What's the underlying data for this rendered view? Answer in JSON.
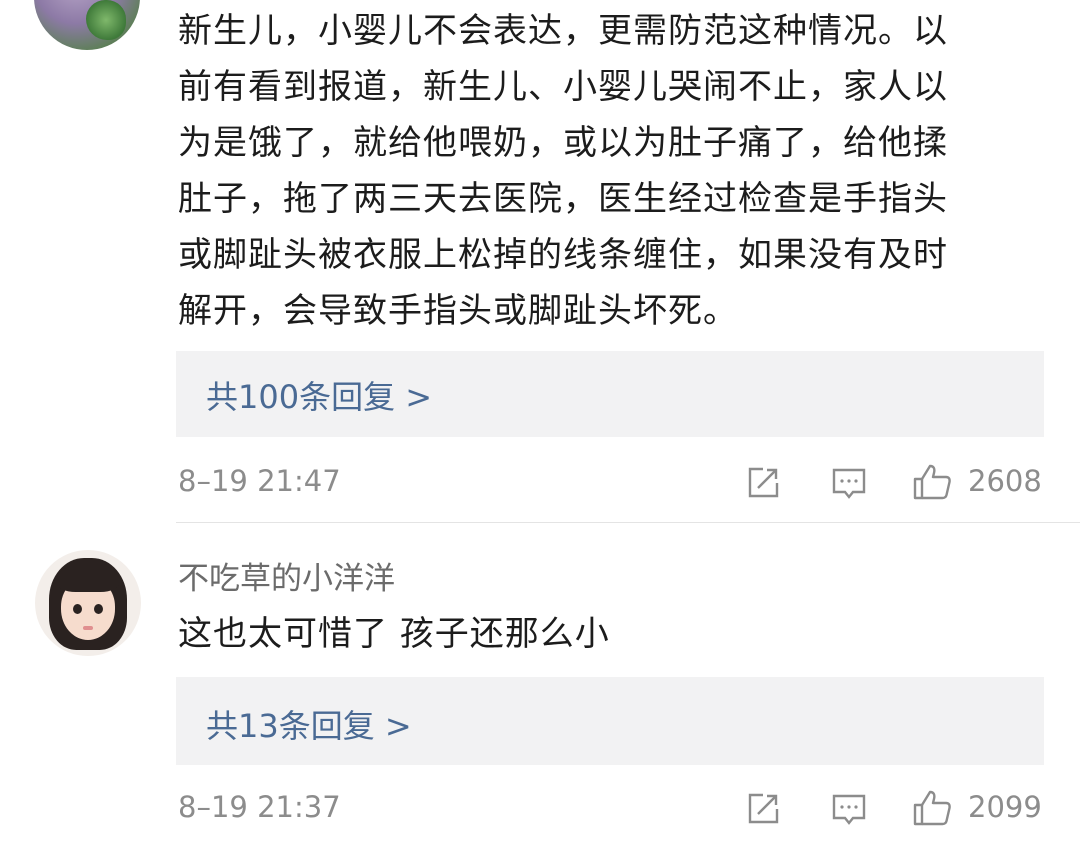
{
  "comments": [
    {
      "text_lines": [
        "新生儿，小婴儿不会表达，更需防范这种情况。以",
        "前有看到报道，新生儿、小婴儿哭闹不止，家人以",
        "为是饿了，就给他喂奶，或以为肚子痛了，给他揉",
        "肚子，拖了两三天去医院，医生经过检查是手指头",
        "或脚趾头被衣服上松掉的线条缠住，如果没有及时",
        "解开，会导致手指头或脚趾头坏死。"
      ],
      "replies_label": "共100条回复 >",
      "time": "8–19 21:47",
      "likes": "2608",
      "icons": [
        "share-icon",
        "comment-icon",
        "like-icon"
      ]
    },
    {
      "username": "不吃草的小洋洋",
      "text": "这也太可惜了 孩子还那么小",
      "replies_label": "共13条回复 >",
      "time": "8–19 21:37",
      "likes": "2099",
      "icons": [
        "share-icon",
        "comment-icon",
        "like-icon"
      ]
    }
  ],
  "colors": {
    "reply_link": "#4a6a94",
    "reply_bg": "#f2f2f3",
    "meta_text": "#8c8c8c",
    "body_text": "#1c1c1c"
  }
}
